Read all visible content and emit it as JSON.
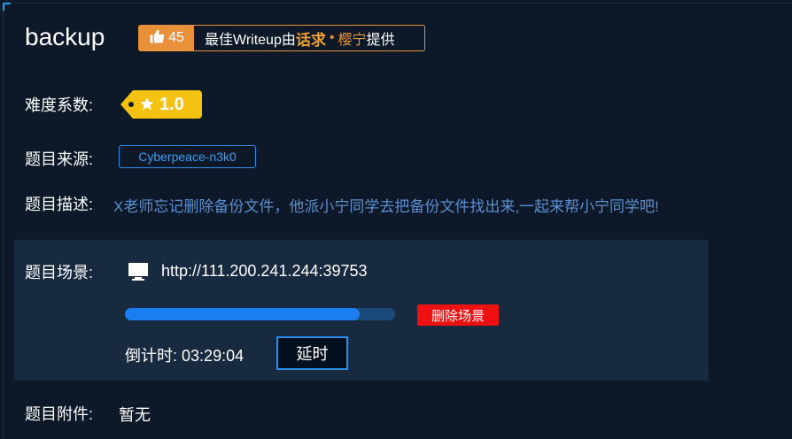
{
  "challenge": {
    "title": "backup",
    "writeup": {
      "likes": "45",
      "prefix": "最佳Writeup由",
      "author": "话求",
      "dot": "•",
      "author2": "樱宁",
      "suffix": "提供"
    },
    "difficulty": {
      "label": "难度系数:",
      "value": "1.0"
    },
    "source": {
      "label": "题目来源:",
      "value": "Cyberpeace-n3k0"
    },
    "description": {
      "label": "题目描述:",
      "value": "X老师忘记删除备份文件，他派小宁同学去把备份文件找出来,一起来帮小宁同学吧!"
    },
    "scene": {
      "label": "题目场景:",
      "url": "http://111.200.241.244:39753",
      "progress": 0.87,
      "delete_label": "删除场景",
      "countdown_label": "倒计时:",
      "countdown_value": "03:29:04",
      "extend_label": "延时"
    },
    "attachment": {
      "label": "题目附件:",
      "value": "暂无"
    }
  },
  "colors": {
    "background": "#0d1829",
    "panel": "#172a40",
    "accent_orange": "#e8903a",
    "accent_blue": "#2f8fe8",
    "difficulty_yellow": "#f5c211",
    "danger": "#ee1111"
  },
  "icons": {
    "like": "thumbs-up-icon",
    "star": "star-icon",
    "monitor": "monitor-icon"
  }
}
